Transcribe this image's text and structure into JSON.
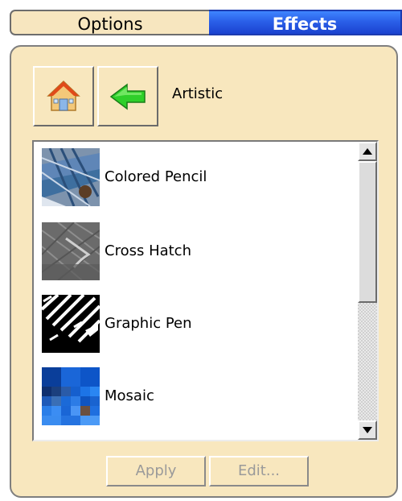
{
  "tabs": {
    "options": "Options",
    "effects": "Effects"
  },
  "toolbar": {
    "home_icon": "home-icon",
    "back_icon": "back-arrow-icon",
    "breadcrumb": "Artistic"
  },
  "effects_list": {
    "items": [
      {
        "label": "Colored Pencil",
        "icon": "colored-pencil-thumbnail"
      },
      {
        "label": "Cross Hatch",
        "icon": "cross-hatch-thumbnail"
      },
      {
        "label": "Graphic Pen",
        "icon": "graphic-pen-thumbnail"
      },
      {
        "label": "Mosaic",
        "icon": "mosaic-thumbnail"
      }
    ]
  },
  "buttons": {
    "apply": "Apply",
    "edit": "Edit..."
  },
  "colors": {
    "panel_bg": "#f8e7be",
    "active_tab": "#2a5fe8",
    "disabled_text": "#9a9a9a"
  }
}
